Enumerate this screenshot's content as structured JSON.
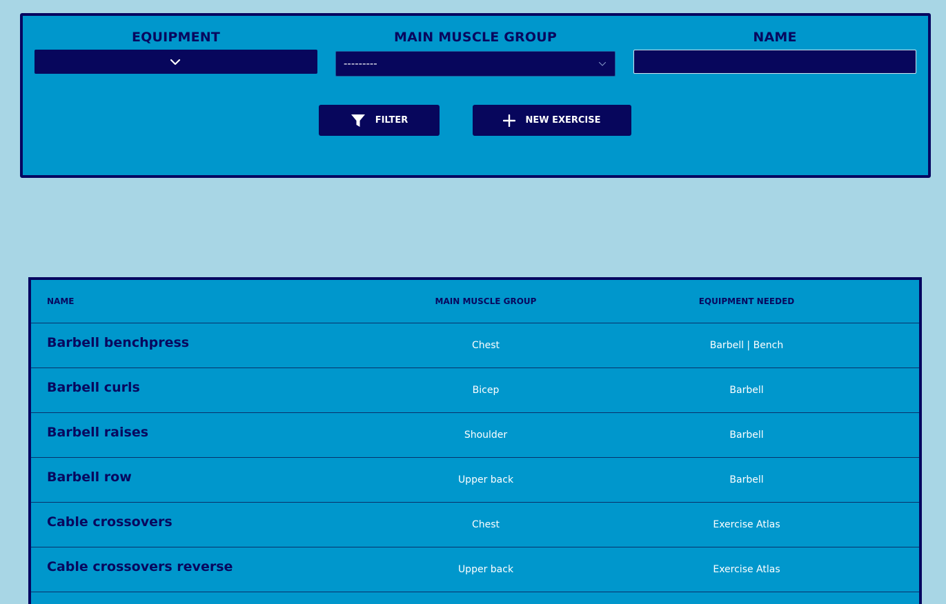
{
  "filters": {
    "equipment": {
      "label": "EQUIPMENT",
      "value": ""
    },
    "muscle": {
      "label": "MAIN MUSCLE GROUP",
      "value": "---------"
    },
    "name": {
      "label": "NAME",
      "value": ""
    }
  },
  "buttons": {
    "filter_label": "FILTER",
    "new_label": "NEW EXERCISE"
  },
  "table": {
    "headers": {
      "name": "NAME",
      "muscle": "MAIN MUSCLE GROUP",
      "equipment": "EQUIPMENT NEEDED"
    },
    "rows": [
      {
        "name": "Barbell benchpress",
        "muscle": "Chest",
        "equipment": "Barbell | Bench"
      },
      {
        "name": "Barbell curls",
        "muscle": "Bicep",
        "equipment": "Barbell"
      },
      {
        "name": "Barbell raises",
        "muscle": "Shoulder",
        "equipment": "Barbell"
      },
      {
        "name": "Barbell row",
        "muscle": "Upper back",
        "equipment": "Barbell"
      },
      {
        "name": "Cable crossovers",
        "muscle": "Chest",
        "equipment": "Exercise Atlas"
      },
      {
        "name": "Cable crossovers reverse",
        "muscle": "Upper back",
        "equipment": "Exercise Atlas"
      }
    ]
  },
  "colors": {
    "page_bg": "#a8d6e5",
    "panel_bg": "#0097cc",
    "dark_navy": "#07065c"
  }
}
